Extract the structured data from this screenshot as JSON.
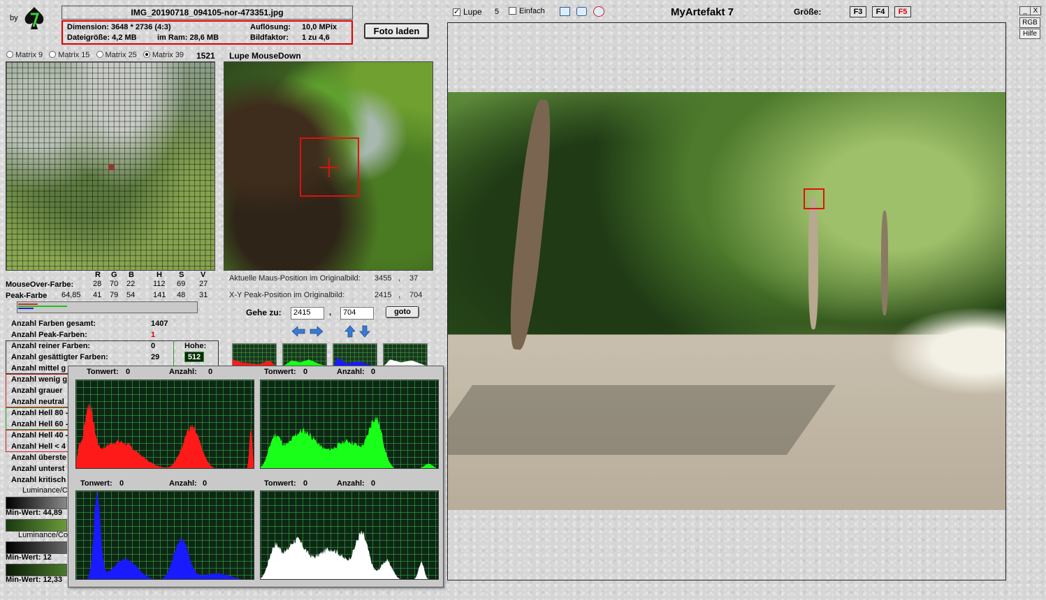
{
  "app": {
    "by_label": "by",
    "title": "MyArtefakt 7",
    "file_name": "IMG_20190718_094105-nor-473351.jpg",
    "foto_button": "Foto laden"
  },
  "info": {
    "dimension": "Dimension: 3648 * 2736 (4:3)",
    "aufloesung_label": "Auflösung:",
    "aufloesung_value": "10,0 MPix",
    "dateigroesse": "Dateigröße: 4,2 MB",
    "ram": "im Ram: 28,6 MB",
    "bildfaktor_label": "Bildfaktor:",
    "bildfaktor_value": "1 zu 4,6"
  },
  "matrix": {
    "options": [
      "Matrix 9",
      "Matrix 15",
      "Matrix 25",
      "Matrix 39"
    ],
    "selected": "Matrix 39",
    "count": "1521"
  },
  "lupe": {
    "title": "Lupe MouseDown"
  },
  "colors": {
    "headers": [
      "R",
      "G",
      "B",
      "H",
      "S",
      "V"
    ],
    "mouseover_label": "MouseOver-Farbe:",
    "mouseover_values": [
      "28",
      "70",
      "22",
      "112",
      "69",
      "27"
    ],
    "peak_label": "Peak-Farbe",
    "peak_extra": "64,85",
    "peak_values": [
      "41",
      "79",
      "54",
      "141",
      "48",
      "31"
    ]
  },
  "position": {
    "mouse_label": "Aktuelle Maus-Position  im Originalbild:",
    "mouse_x": "3455",
    "mouse_y": "37",
    "peak_label": "X-Y Peak-Position  im Originalbild:",
    "peak_x": "2415",
    "peak_y": "704",
    "sep": ",",
    "goto_label": "Gehe zu:",
    "goto_x": "2415",
    "goto_y": "704",
    "goto_button": "goto"
  },
  "stats": {
    "gesamt_label": "Anzahl Farben gesamt:",
    "gesamt_value": "1407",
    "peak_label": "Anzahl Peak-Farben:",
    "peak_value": "1",
    "rein_label": "Anzahl reiner Farben:",
    "rein_value": "0",
    "hohe_label": "Hohe:",
    "hohe_value": "512",
    "gesaettigt_label": "Anzahl gesättigter Farben:",
    "gesaettigt_value": "29",
    "mittel_label": "Anzahl mittel g",
    "wenig_label": "Anzahl wenig g",
    "grauer_label": "Anzahl grauer",
    "neutral_label": "Anzahl neutral",
    "hell80_label": "Anzahl Hell 80 -",
    "hell60_label": "Anzahl Hell 60 -",
    "hell40_label": "Anzahl Hell 40 -",
    "hellu40_label": "Anzahl Hell < 4",
    "ueber_label": "Anzahl überste",
    "unter_label": "Anzahl unterst",
    "krit_label": "Anzahl kritisch"
  },
  "luminance": {
    "label1": "Luminance/C",
    "min1": "Min-Wert: 44,89",
    "label2": "Luminance/Co",
    "min2": "Min-Wert: 12",
    "min3": "Min-Wert: 12,33"
  },
  "histogram": {
    "tonwert_label": "Tonwert:",
    "anzahl_label": "Anzahl:",
    "panels": [
      {
        "name": "red",
        "color": "#ff1a1a",
        "tonwert": "0",
        "anzahl": "0"
      },
      {
        "name": "green",
        "color": "#1aff1a",
        "tonwert": "0",
        "anzahl": "0"
      },
      {
        "name": "blue",
        "color": "#1a1aff",
        "tonwert": "0",
        "anzahl": "0"
      },
      {
        "name": "luminance",
        "color": "#ffffff",
        "tonwert": "0",
        "anzahl": "0"
      }
    ]
  },
  "toolbar": {
    "lupe_label": "Lupe",
    "lupe_checked": true,
    "lupe_size": "5",
    "einfach_label": "Einfach",
    "einfach_checked": false,
    "groesse_label": "Größe:",
    "f3": "F3",
    "f4": "F4",
    "f5": "F5",
    "active_color": "#e00000"
  },
  "window": {
    "minimize": "_",
    "close": "X",
    "rgb_button": "RGB",
    "hilfe_button": "Hilfe"
  }
}
